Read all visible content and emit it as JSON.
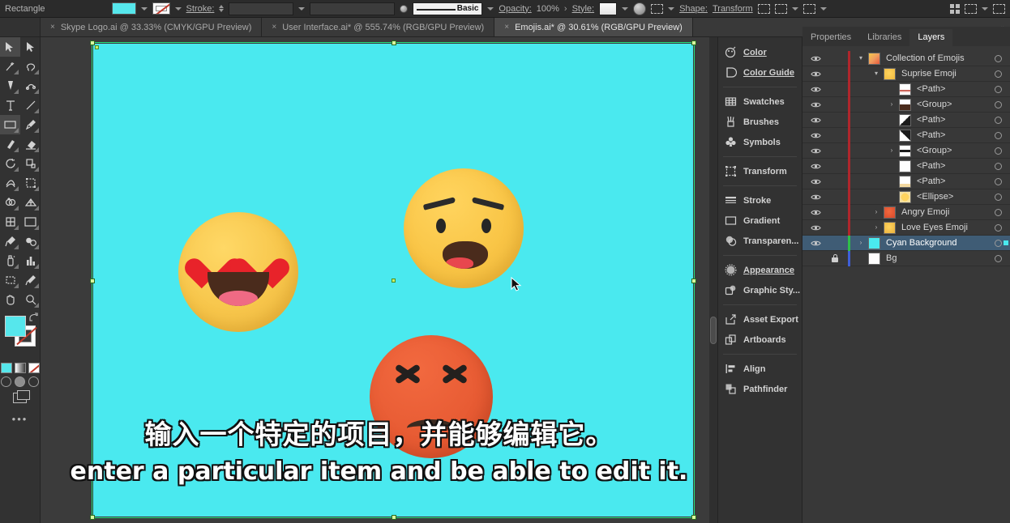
{
  "control_bar": {
    "shape_label": "Rectangle",
    "fill_color": "#56e7ec",
    "stroke_label": "Stroke:",
    "stroke_weight": "",
    "stroke_profile": "",
    "brush_label": "Basic",
    "opacity_label": "Opacity:",
    "opacity_value": "100%",
    "style_label": "Style:",
    "shape_menu_label": "Shape:",
    "transform_label": "Transform",
    "icons": [
      "fill-swatch",
      "fill-dropdown-icon",
      "stroke-swatch",
      "stroke-dropdown-icon",
      "stroke-weight-stepper",
      "stroke-style-dropdown-icon",
      "variable-width-dropdown-icon",
      "brush-definition-dropdown-icon",
      "opacity-more-icon",
      "graphic-style-dropdown-icon",
      "recolor-artwork-icon",
      "align-dropdown-icon",
      "arrange-icon",
      "align-icon",
      "distribute-dropdown-icon",
      "select-similar-icon",
      "select-similar-dropdown-icon",
      "more-options-dropdown-icon",
      "document-setup-icon",
      "preferences-icon",
      "workspace-switcher-dropdown-icon",
      "panel-list-icon"
    ]
  },
  "document_tabs": [
    {
      "title": "Skype Logo.ai @ 33.33% (CMYK/GPU Preview)",
      "active": false,
      "close": "×"
    },
    {
      "title": "User Interface.ai* @ 555.74% (RGB/GPU Preview)",
      "active": false,
      "close": "×"
    },
    {
      "title": "Emojis.ai* @ 30.61% (RGB/GPU Preview)",
      "active": true,
      "close": "×"
    }
  ],
  "tabbar": {
    "overflow_icon": "chevron-double-icon"
  },
  "toolbar": {
    "tools": [
      {
        "name": "selection-tool",
        "selected": true
      },
      {
        "name": "direct-selection-tool",
        "selected": false
      },
      {
        "name": "magic-wand-tool",
        "selected": false
      },
      {
        "name": "lasso-tool",
        "selected": false
      },
      {
        "name": "pen-tool",
        "selected": false
      },
      {
        "name": "curvature-tool",
        "selected": false
      },
      {
        "name": "type-tool",
        "selected": false
      },
      {
        "name": "line-segment-tool",
        "selected": false
      },
      {
        "name": "rectangle-tool",
        "selected": true
      },
      {
        "name": "paintbrush-tool",
        "selected": false
      },
      {
        "name": "shaper-tool",
        "selected": false
      },
      {
        "name": "eraser-tool",
        "selected": false
      },
      {
        "name": "rotate-tool",
        "selected": false
      },
      {
        "name": "scale-tool",
        "selected": false
      },
      {
        "name": "width-tool",
        "selected": false
      },
      {
        "name": "free-transform-tool",
        "selected": false
      },
      {
        "name": "shape-builder-tool",
        "selected": false
      },
      {
        "name": "perspective-grid-tool",
        "selected": false
      },
      {
        "name": "mesh-tool",
        "selected": false
      },
      {
        "name": "gradient-tool",
        "selected": false
      },
      {
        "name": "eyedropper-tool",
        "selected": false
      },
      {
        "name": "blend-tool",
        "selected": false
      },
      {
        "name": "symbol-sprayer-tool",
        "selected": false
      },
      {
        "name": "column-graph-tool",
        "selected": false
      },
      {
        "name": "artboard-tool",
        "selected": false
      },
      {
        "name": "slice-tool",
        "selected": false
      },
      {
        "name": "hand-tool",
        "selected": false
      },
      {
        "name": "zoom-tool",
        "selected": false
      }
    ],
    "fill_color": "#56e7ec",
    "stroke_color": "#ffffff",
    "more_tools_label": "•••"
  },
  "dock": {
    "groups": [
      [
        {
          "label": "Color",
          "icon": "color-panel-icon",
          "underline": true
        },
        {
          "label": "Color Guide",
          "icon": "color-guide-icon",
          "underline": true
        }
      ],
      [
        {
          "label": "Swatches",
          "icon": "swatches-icon",
          "underline": false
        },
        {
          "label": "Brushes",
          "icon": "brushes-icon",
          "underline": false
        },
        {
          "label": "Symbols",
          "icon": "symbols-icon",
          "underline": false
        }
      ],
      [
        {
          "label": "Transform",
          "icon": "transform-icon",
          "underline": false
        }
      ],
      [
        {
          "label": "Stroke",
          "icon": "stroke-icon",
          "underline": false
        },
        {
          "label": "Gradient",
          "icon": "gradient-icon",
          "underline": false
        },
        {
          "label": "Transparen...",
          "icon": "transparency-icon",
          "underline": false
        }
      ],
      [
        {
          "label": "Appearance",
          "icon": "appearance-icon",
          "underline": true
        },
        {
          "label": "Graphic Sty...",
          "icon": "graphic-styles-icon",
          "underline": false
        }
      ],
      [
        {
          "label": "Asset Export",
          "icon": "asset-export-icon",
          "underline": false
        },
        {
          "label": "Artboards",
          "icon": "artboards-icon",
          "underline": false
        }
      ],
      [
        {
          "label": "Align",
          "icon": "align-icon",
          "underline": false
        },
        {
          "label": "Pathfinder",
          "icon": "pathfinder-icon",
          "underline": false
        }
      ]
    ]
  },
  "right_panel": {
    "tabs": [
      {
        "label": "Properties",
        "active": false
      },
      {
        "label": "Libraries",
        "active": false
      },
      {
        "label": "Layers",
        "active": true
      }
    ],
    "layers": [
      {
        "name": "Collection of Emojis",
        "indent": 0,
        "twisty": "▾",
        "thumb": "e-collection",
        "visible": true,
        "locked": false,
        "selected": false,
        "color": "#b0262c"
      },
      {
        "name": "Suprise Emoji",
        "indent": 1,
        "twisty": "▾",
        "thumb": "e-surprise",
        "visible": true,
        "locked": false,
        "selected": false,
        "color": "#b0262c"
      },
      {
        "name": "<Path>",
        "indent": 2,
        "twisty": "",
        "thumb": "e-mouth",
        "visible": true,
        "locked": false,
        "selected": false,
        "color": "#b0262c"
      },
      {
        "name": "<Group>",
        "indent": 2,
        "twisty": "›",
        "thumb": "e-group",
        "visible": true,
        "locked": false,
        "selected": false,
        "color": "#b0262c"
      },
      {
        "name": "<Path>",
        "indent": 2,
        "twisty": "",
        "thumb": "e-brow",
        "visible": true,
        "locked": false,
        "selected": false,
        "color": "#b0262c"
      },
      {
        "name": "<Path>",
        "indent": 2,
        "twisty": "",
        "thumb": "e-brow2",
        "visible": true,
        "locked": false,
        "selected": false,
        "color": "#b0262c"
      },
      {
        "name": "<Group>",
        "indent": 2,
        "twisty": "›",
        "thumb": "e-eyes",
        "visible": true,
        "locked": false,
        "selected": false,
        "color": "#b0262c"
      },
      {
        "name": "<Path>",
        "indent": 2,
        "twisty": "",
        "thumb": "e-white",
        "visible": true,
        "locked": false,
        "selected": false,
        "color": "#b0262c"
      },
      {
        "name": "<Path>",
        "indent": 2,
        "twisty": "",
        "thumb": "e-path-p",
        "visible": true,
        "locked": false,
        "selected": false,
        "color": "#b0262c"
      },
      {
        "name": "<Ellipse>",
        "indent": 2,
        "twisty": "",
        "thumb": "e-ellipse",
        "visible": true,
        "locked": false,
        "selected": false,
        "color": "#b0262c"
      },
      {
        "name": "Angry Emoji",
        "indent": 1,
        "twisty": "›",
        "thumb": "e-angry",
        "visible": true,
        "locked": false,
        "selected": false,
        "color": "#b0262c"
      },
      {
        "name": "Love Eyes Emoji",
        "indent": 1,
        "twisty": "›",
        "thumb": "e-love",
        "visible": true,
        "locked": false,
        "selected": false,
        "color": "#b0262c"
      },
      {
        "name": "Cyan Background",
        "indent": 0,
        "twisty": "›",
        "thumb": "e-cyan",
        "visible": true,
        "locked": false,
        "selected": true,
        "color": "#2fbf4a"
      },
      {
        "name": "Bg",
        "indent": 0,
        "twisty": "",
        "thumb": "e-white",
        "visible": false,
        "locked": true,
        "selected": false,
        "color": "#3f5fd8"
      }
    ]
  },
  "canvas": {
    "background_color": "#4ae9ef",
    "selection_color": "#22e17e",
    "objects": [
      {
        "name": "love-eyes-emoji",
        "color": "#f2c345"
      },
      {
        "name": "surprise-emoji",
        "color": "#f7c646"
      },
      {
        "name": "angry-emoji",
        "color": "#e85c34"
      }
    ],
    "cursor": "selection-arrow-cursor"
  },
  "subtitles": {
    "chinese": "输入一个特定的项目，并能够编辑它。",
    "english": "enter a particular item and be able to edit it."
  }
}
